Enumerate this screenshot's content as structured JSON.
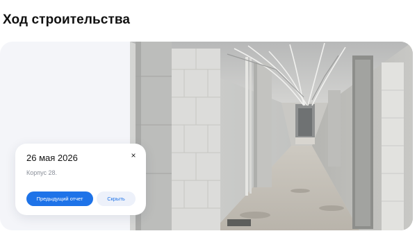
{
  "section": {
    "title": "Ход строительства"
  },
  "report": {
    "date": "26 мая 2026",
    "building": "Корпус 28.",
    "close_glyph": "×",
    "previous_report_label": "Предыдущий отчет",
    "hide_label": "Скрыть"
  },
  "colors": {
    "accent": "#1e73e8",
    "card_background": "#f4f5f9",
    "hide_button_background": "#edf1fa",
    "muted_text": "#8a8f99"
  },
  "icons": {
    "close": "close-icon"
  }
}
